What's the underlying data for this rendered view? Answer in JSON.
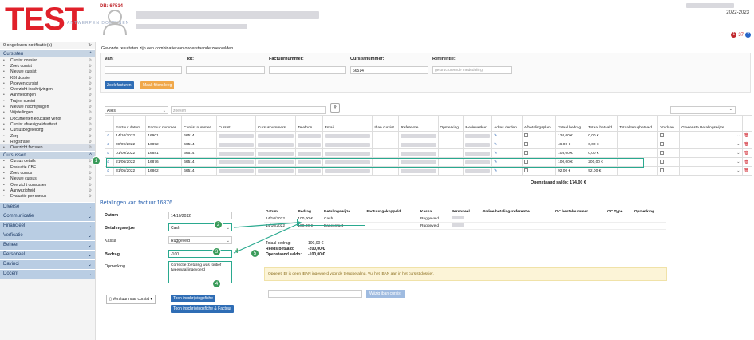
{
  "header": {
    "logo": "TEST",
    "logo_sub": "ANTWERPEN DOMEINEN",
    "db": "DB: 67514",
    "year": "2022-2023",
    "badge_count": "1",
    "alert_count": "37",
    "help": "?"
  },
  "sidebar": {
    "notifications": "0 ongelezen notificatie(s)",
    "section_cursisten": "Cursisten",
    "cursisten_items": [
      "Cursist dossier",
      "Zoek cursist",
      "Nieuwe cursist",
      "KBI dossier",
      "Proeven cursist",
      "Overzicht inschrijvingen",
      "Aanmeldingen",
      "Traject cursist",
      "Nieuwe inschrijvingen",
      "Vrijstellingen",
      "Documenten educatief verlof",
      "Cursist afwezigheidsattest",
      "Cursusbegeleiding",
      "Zorg",
      "Registratie",
      "Overzicht facturen"
    ],
    "section_cursussen": "Cursussen",
    "cursussen_items": [
      "Cursus details",
      "Evaluatie CBE",
      "Zoek cursus",
      "Nieuwe cursus",
      "Overzicht cursussen",
      "Aanwezigheid",
      "Evaluatie per cursus"
    ],
    "collapsed": [
      "Diverse",
      "Communicatie",
      "Financieel",
      "Verficatie",
      "Beheer",
      "Personeel",
      "Davinci",
      "Docent"
    ]
  },
  "search": {
    "intro": "Gevonde resultaten zijn een combinatie van onderstaande zoekvelden.",
    "van": "Van:",
    "tot": "Tot:",
    "factuurnummer": "Factuurnummer:",
    "cursistnummer": "Cursistnummer:",
    "referentie": "Referentie:",
    "cursistnummer_value": "66514",
    "referentie_placeholder": "gestructureerde mededeling",
    "btn_search": "Zoek facturen",
    "btn_clear": "Maak filters leeg"
  },
  "filter": {
    "select": "Alles",
    "search_placeholder": "zoeken"
  },
  "table": {
    "headers": [
      "Factuur datum",
      "Factuur nummer",
      "Cursist nummer",
      "Cursist",
      "Cursusnummers",
      "Telefoon",
      "Email",
      "Iban cursist",
      "Referentie",
      "Opmerking",
      "Medewerker",
      "Adres derden",
      "Afbetalingsplan",
      "Totaal bedrag",
      "Totaal betaald",
      "Totaal terugbetaald",
      "Voldaan",
      "Gewenste Betalingswijze"
    ],
    "rows": [
      {
        "datum": "14/10/2022",
        "nummer": "16901",
        "cursist": "66514",
        "bedrag": "120,00 €",
        "betaald": "0,00 €",
        "terug": ""
      },
      {
        "datum": "08/09/2022",
        "nummer": "16892",
        "cursist": "66514",
        "bedrag": "46,00 €",
        "betaald": "0,00 €",
        "terug": ""
      },
      {
        "datum": "01/09/2022",
        "nummer": "16881",
        "cursist": "66514",
        "bedrag": "108,00 €",
        "betaald": "0,00 €",
        "terug": ""
      },
      {
        "datum": "21/06/2022",
        "nummer": "16876",
        "cursist": "66514",
        "bedrag": "100,00 €",
        "betaald": "200,00 €",
        "terug": ""
      },
      {
        "datum": "31/05/2022",
        "nummer": "16862",
        "cursist": "66514",
        "bedrag": "92,00 €",
        "betaald": "92,00 €",
        "terug": ""
      }
    ],
    "saldo": "Openstaand saldo: 174,00 €"
  },
  "payment": {
    "title": "Betalingen van factuur 16876",
    "datum_label": "Datum",
    "datum_value": "14/10/2022",
    "wijze_label": "Betalingswijze",
    "wijze_value": "Cash",
    "kassa_label": "Kassa",
    "kassa_value": "Ruggeveld",
    "bedrag_label": "Bedrag",
    "bedrag_value": "-100",
    "opmerking_label": "Opmerking",
    "opmerking_value": "Correctie: betaling was foutief tweemaal ingevoerd",
    "btn_verstuur": "Verstuur naar cursist",
    "btn_fiche": "Toon inschrijvingsfiche",
    "btn_fiche_factuur": "Toon inschrijvingsfiche & Factuur",
    "cols": [
      "Datum",
      "Bedrag",
      "Betalingswijze",
      "Factuur gekoppeld",
      "Kassa",
      "Personeel",
      "Online betalingsreferentie",
      "OC bestelnummer",
      "OC Type",
      "Opmerking"
    ],
    "rows": [
      {
        "datum": "14/10/2022",
        "bedrag": "100,00 €",
        "wijze": "Cash",
        "kassa": "Ruggeveld"
      },
      {
        "datum": "14/10/2022",
        "bedrag": "100,00 €",
        "wijze": "Bancontact",
        "kassa": "Ruggeveld"
      }
    ],
    "totaal_label": "Totaal bedrag:",
    "totaal_value": "100,00 €",
    "betaald_label": "Reeds betaald:",
    "betaald_value": "-200,00 €",
    "saldo_label": "Openstaand saldo:",
    "saldo_value": "-100,00 €",
    "warning": "Opgelet! Er is geen IBAN ingevoerd voor de terugbetaling. Vul het IBAN aan in het cursist dossier.",
    "btn_iban": "Wijzig iban cursist"
  },
  "callouts": [
    "1",
    "2",
    "3",
    "4",
    "5"
  ]
}
